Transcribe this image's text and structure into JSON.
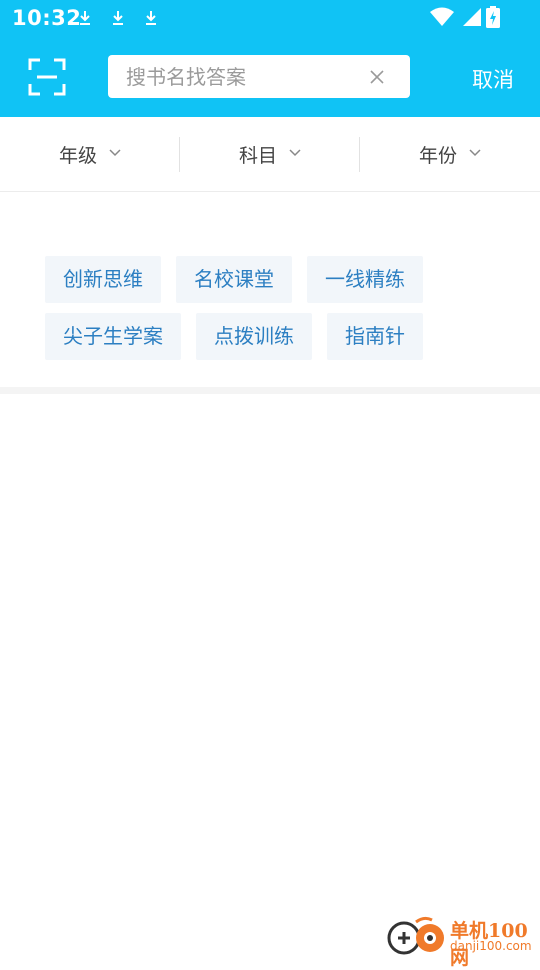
{
  "status_bar": {
    "time": "10:32"
  },
  "header": {
    "search_placeholder": "搜书名找答案",
    "cancel_label": "取消"
  },
  "filters": [
    {
      "label": "年级"
    },
    {
      "label": "科目"
    },
    {
      "label": "年份"
    }
  ],
  "tag_rows": [
    [
      "创新思维",
      "名校课堂",
      "一线精练"
    ],
    [
      "尖子生学案",
      "点拨训练",
      "指南针"
    ]
  ],
  "watermark": {
    "title": "单机100网",
    "url": "danji100.com"
  },
  "colors": {
    "header_bg": "#10C3F5",
    "tag_bg": "#F2F6FA",
    "tag_text": "#2C7FC2",
    "watermark": "#F07A2A"
  }
}
